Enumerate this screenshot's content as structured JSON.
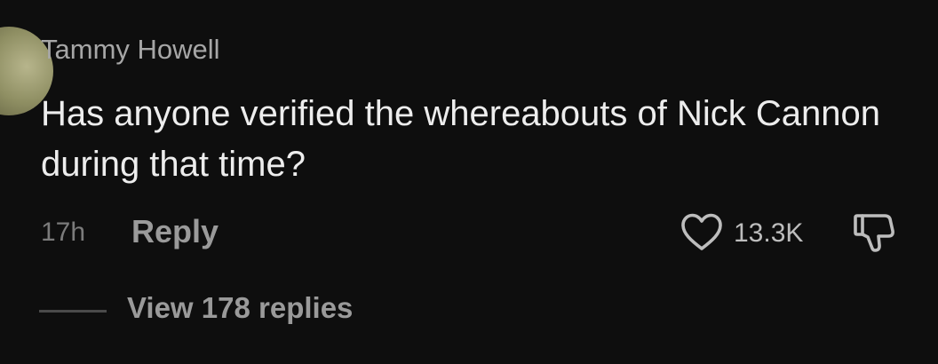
{
  "comment": {
    "author": "Tammy Howell",
    "text": "Has anyone verified the whereabouts of Nick Cannon during that time?",
    "timestamp": "17h",
    "reply_label": "Reply",
    "like_count": "13.3K",
    "like_icon": "heart-outline-icon",
    "dislike_icon": "thumbs-down-icon",
    "view_replies_label": "View 178 replies"
  },
  "colors": {
    "background": "#0e0e0e",
    "author": "#a6a6a6",
    "text": "#ededed",
    "muted": "#7b7b7b",
    "action": "#9a9a9a"
  }
}
